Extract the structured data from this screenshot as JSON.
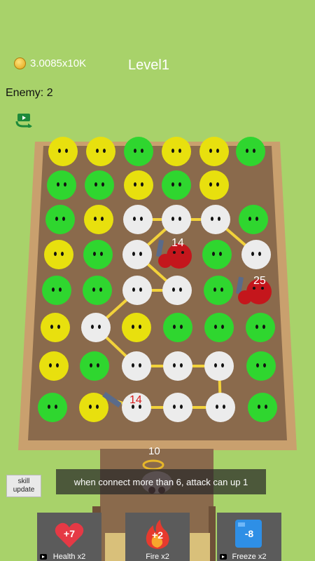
{
  "hud": {
    "coins": "3.0085x10K",
    "level": "Level1",
    "enemy": "Enemy: 2"
  },
  "colors": {
    "background": "#a8d26a",
    "board_floor": "#8a6a4c",
    "board_wall": "#c9a06e",
    "yellow_ball": "#e8e00e",
    "green_ball": "#2fd62f",
    "white_ball": "#ececec",
    "link_line": "#f2d23a",
    "enemy_red": "#c4161c"
  },
  "enemies": [
    {
      "hp": "14"
    },
    {
      "hp": "25"
    },
    {
      "hp": "14"
    }
  ],
  "player": {
    "hp": "10"
  },
  "tip": "when connect more than 6, attack can up 1",
  "skill_button": {
    "line1": "skill",
    "line2": "update"
  },
  "cards": [
    {
      "value": "+7",
      "label": "Health x2",
      "icon": "heart-icon"
    },
    {
      "value": "+2",
      "label": "Fire x2",
      "icon": "fire-icon"
    },
    {
      "value": "-8",
      "label": "Freeze x2",
      "icon": "ice-cube-icon"
    }
  ]
}
